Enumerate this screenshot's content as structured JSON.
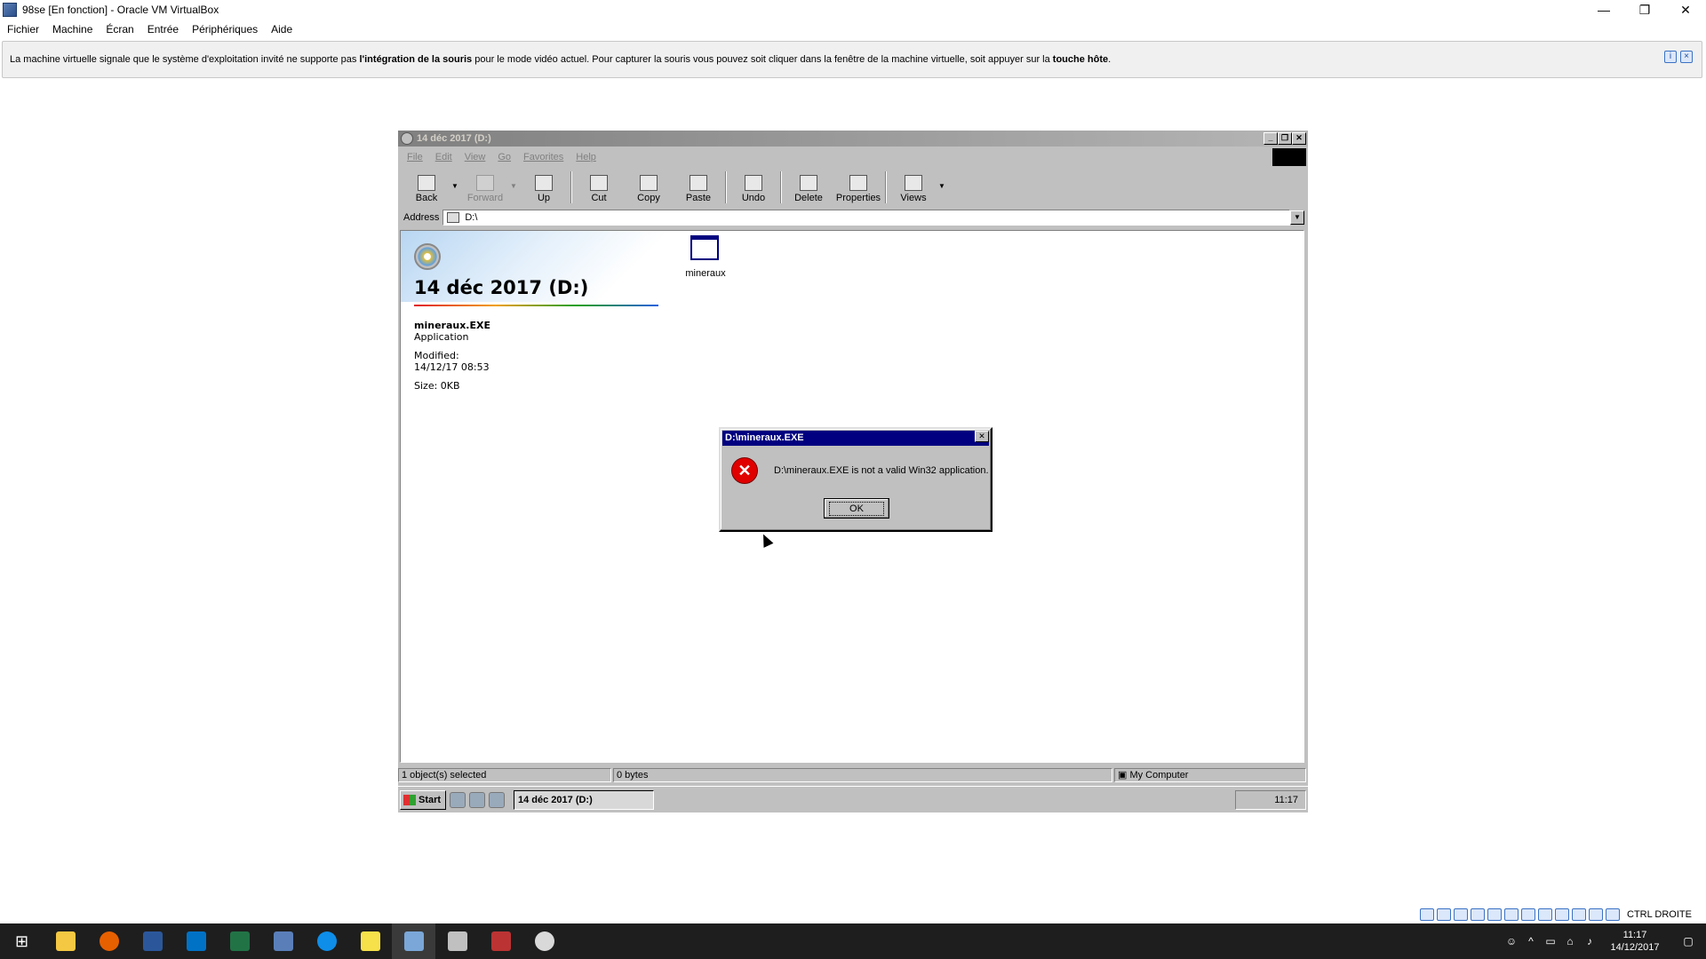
{
  "host": {
    "title": "98se [En fonction] - Oracle VM VirtualBox",
    "menu": [
      "Fichier",
      "Machine",
      "Écran",
      "Entrée",
      "Périphériques",
      "Aide"
    ],
    "notice": {
      "part1": "La machine virtuelle signale que le système d'exploitation invité ne supporte pas ",
      "bold1": "l'intégration de la souris",
      "part2": " pour le mode vidéo actuel. Pour capturer la souris vous pouvez soit cliquer dans la fenêtre de la machine virtuelle, soit appuyer sur la ",
      "bold2": "touche hôte",
      "part3": "."
    },
    "host_key": "CTRL DROITE"
  },
  "explorer": {
    "title": "14 déc    2017 (D:)",
    "menu": [
      "File",
      "Edit",
      "View",
      "Go",
      "Favorites",
      "Help"
    ],
    "toolbar": [
      {
        "label": "Back",
        "icon": "back-arrow-icon",
        "disabled": false
      },
      {
        "label": "Forward",
        "icon": "forward-arrow-icon",
        "disabled": true
      },
      {
        "label": "Up",
        "icon": "up-folder-icon",
        "disabled": false
      },
      {
        "label": "Cut",
        "icon": "scissors-icon",
        "disabled": false
      },
      {
        "label": "Copy",
        "icon": "copy-icon",
        "disabled": false
      },
      {
        "label": "Paste",
        "icon": "paste-icon",
        "disabled": false
      },
      {
        "label": "Undo",
        "icon": "undo-icon",
        "disabled": false
      },
      {
        "label": "Delete",
        "icon": "delete-x-icon",
        "disabled": false
      },
      {
        "label": "Properties",
        "icon": "properties-icon",
        "disabled": false
      },
      {
        "label": "Views",
        "icon": "views-icon",
        "disabled": false
      }
    ],
    "address_label": "Address",
    "address_value": "D:\\",
    "volume_title": "14 déc 2017 (D:)",
    "selected": {
      "name": "mineraux.EXE",
      "type": "Application",
      "modified_label": "Modified:",
      "modified_value": "14/12/17 08:53",
      "size": "Size: 0KB"
    },
    "file_label": "mineraux",
    "status": [
      "1 object(s) selected",
      "0 bytes",
      "My Computer"
    ]
  },
  "guest_taskbar": {
    "start": "Start",
    "task": "14 déc    2017 (D:)",
    "time": "11:17"
  },
  "dialog": {
    "title": "D:\\mineraux.EXE",
    "message": "D:\\mineraux.EXE is not a valid Win32 application.",
    "ok": "OK"
  },
  "win_taskbar": {
    "time": "11:17",
    "date": "14/12/2017"
  }
}
